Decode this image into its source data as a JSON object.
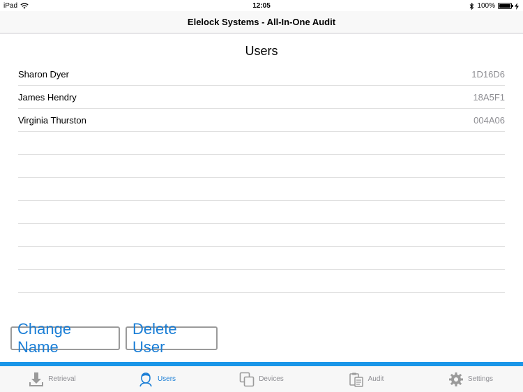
{
  "status_bar": {
    "device": "iPad",
    "time": "12:05",
    "battery": "100%"
  },
  "nav": {
    "title": "Elelock Systems - All-In-One Audit"
  },
  "section": {
    "title": "Users"
  },
  "users": [
    {
      "name": "Sharon Dyer",
      "code": "1D16D6"
    },
    {
      "name": "James Hendry",
      "code": "18A5F1"
    },
    {
      "name": "Virginia Thurston",
      "code": "004A06"
    }
  ],
  "buttons": {
    "change_name": "Change Name",
    "delete_user": "Delete User"
  },
  "tabs": [
    {
      "label": "Retrieval",
      "icon": "download-icon"
    },
    {
      "label": "Users",
      "icon": "user-icon"
    },
    {
      "label": "Devices",
      "icon": "devices-icon"
    },
    {
      "label": "Audit",
      "icon": "clipboard-icon"
    },
    {
      "label": "Settings",
      "icon": "gear-icon"
    }
  ],
  "colors": {
    "accent": "#1a96e8",
    "button_text": "#1a7ed6",
    "active_tab": "#1a7ed6",
    "inactive_tab": "#8e8e93"
  }
}
